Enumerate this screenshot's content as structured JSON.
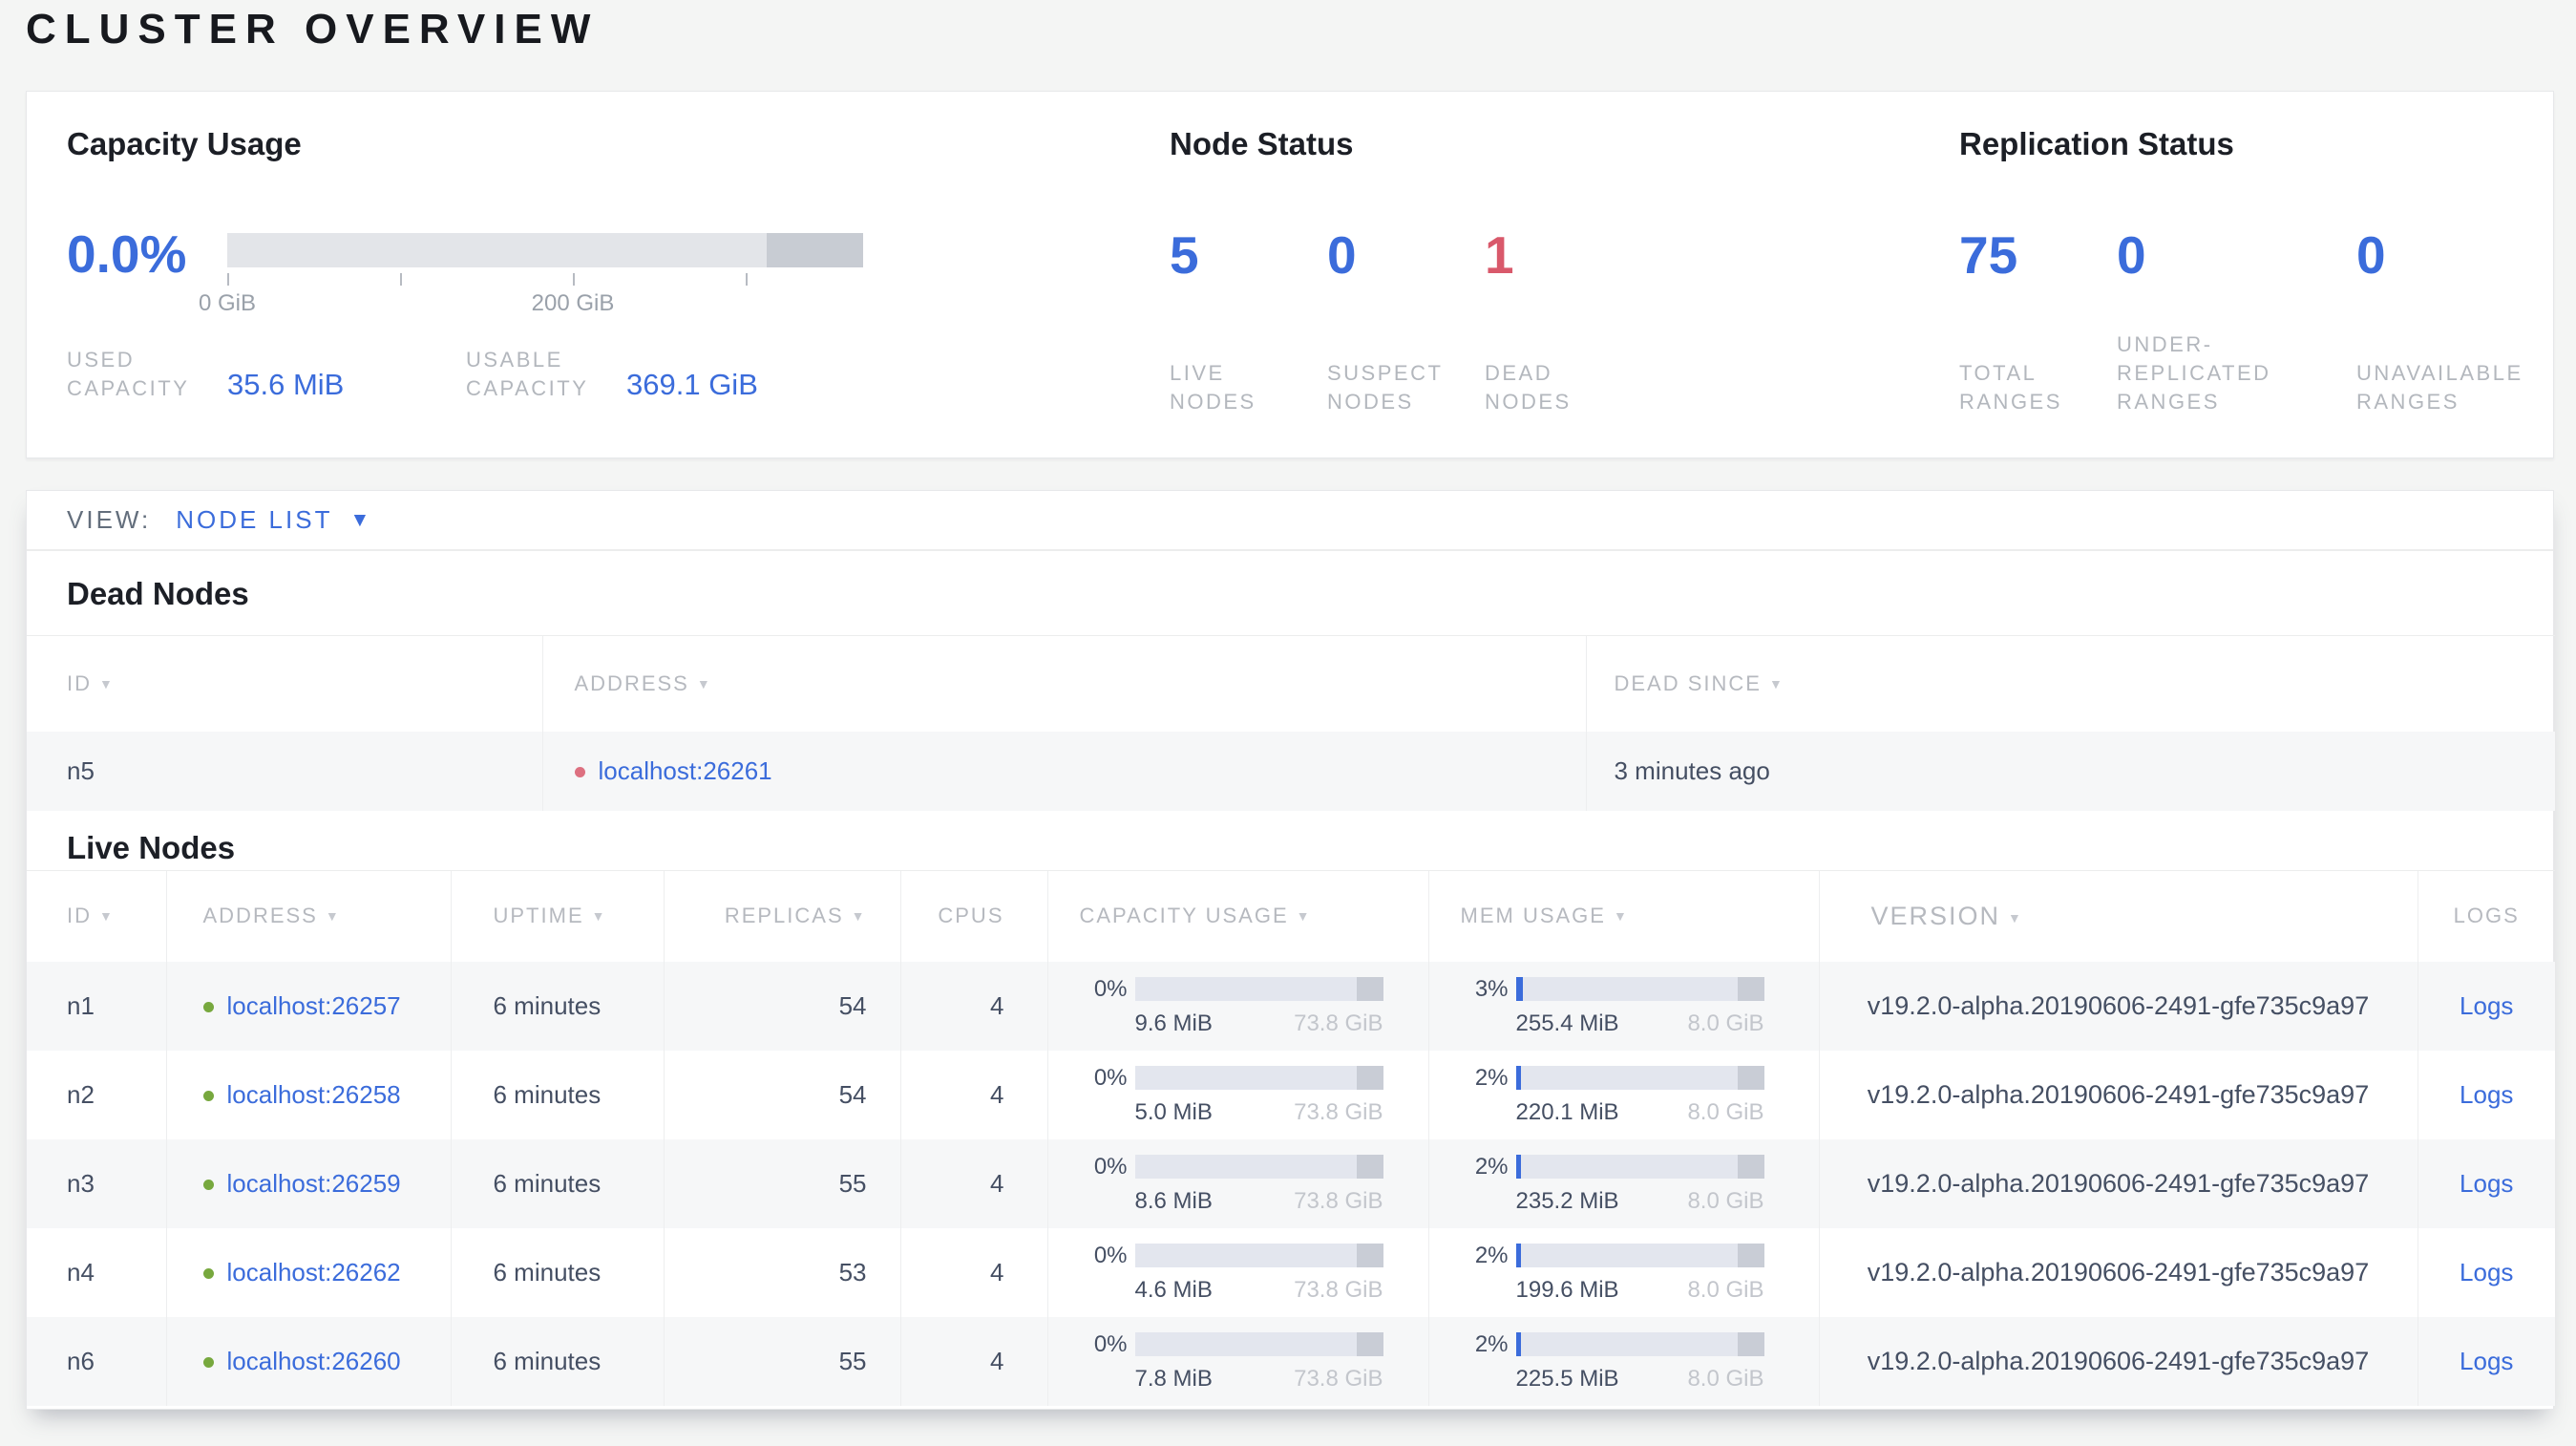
{
  "page_title": "CLUSTER OVERVIEW",
  "colors": {
    "accent_blue": "#3b6cdb",
    "danger_red": "#d9596b",
    "healthy_green": "#77a83e"
  },
  "capacity": {
    "title": "Capacity Usage",
    "percent": "0.0%",
    "tick_labels": [
      "0 GiB",
      "200 GiB"
    ],
    "used": {
      "label": "USED CAPACITY",
      "value": "35.6 MiB"
    },
    "usable": {
      "label": "USABLE CAPACITY",
      "value": "369.1 GiB"
    }
  },
  "node_status": {
    "title": "Node Status",
    "stats": [
      {
        "value": "5",
        "label": "LIVE NODES"
      },
      {
        "value": "0",
        "label": "SUSPECT NODES"
      },
      {
        "value": "1",
        "label": "DEAD NODES"
      }
    ]
  },
  "replication_status": {
    "title": "Replication Status",
    "stats": [
      {
        "value": "75",
        "label": "TOTAL RANGES"
      },
      {
        "value": "0",
        "label": "UNDER-REPLICATED RANGES"
      },
      {
        "value": "0",
        "label": "UNAVAILABLE RANGES"
      }
    ]
  },
  "view_bar": {
    "label": "VIEW:",
    "selected": "NODE LIST"
  },
  "dead_nodes": {
    "title": "Dead Nodes",
    "headers": {
      "id": "ID",
      "address": "ADDRESS",
      "dead_since": "DEAD SINCE"
    },
    "rows": [
      {
        "id": "n5",
        "address": "localhost:26261",
        "dead_since": "3 minutes ago"
      }
    ]
  },
  "live_nodes": {
    "title": "Live Nodes",
    "headers": {
      "id": "ID",
      "address": "ADDRESS",
      "uptime": "UPTIME",
      "replicas": "REPLICAS",
      "cpus": "CPUS",
      "capacity": "CAPACITY USAGE",
      "memory": "MEM USAGE",
      "version": "VERSION",
      "logs": "LOGS"
    },
    "rows": [
      {
        "id": "n1",
        "address": "localhost:26257",
        "uptime": "6 minutes",
        "replicas": "54",
        "cpus": "4",
        "cap_pct": "0%",
        "cap_fill": "0%",
        "cap_used": "9.6 MiB",
        "cap_total": "73.8 GiB",
        "mem_pct": "3%",
        "mem_fill": "3%",
        "mem_used": "255.4 MiB",
        "mem_total": "8.0 GiB",
        "version": "v19.2.0-alpha.20190606-2491-gfe735c9a97",
        "logs": "Logs"
      },
      {
        "id": "n2",
        "address": "localhost:26258",
        "uptime": "6 minutes",
        "replicas": "54",
        "cpus": "4",
        "cap_pct": "0%",
        "cap_fill": "0%",
        "cap_used": "5.0 MiB",
        "cap_total": "73.8 GiB",
        "mem_pct": "2%",
        "mem_fill": "2%",
        "mem_used": "220.1 MiB",
        "mem_total": "8.0 GiB",
        "version": "v19.2.0-alpha.20190606-2491-gfe735c9a97",
        "logs": "Logs"
      },
      {
        "id": "n3",
        "address": "localhost:26259",
        "uptime": "6 minutes",
        "replicas": "55",
        "cpus": "4",
        "cap_pct": "0%",
        "cap_fill": "0%",
        "cap_used": "8.6 MiB",
        "cap_total": "73.8 GiB",
        "mem_pct": "2%",
        "mem_fill": "2%",
        "mem_used": "235.2 MiB",
        "mem_total": "8.0 GiB",
        "version": "v19.2.0-alpha.20190606-2491-gfe735c9a97",
        "logs": "Logs"
      },
      {
        "id": "n4",
        "address": "localhost:26262",
        "uptime": "6 minutes",
        "replicas": "53",
        "cpus": "4",
        "cap_pct": "0%",
        "cap_fill": "0%",
        "cap_used": "4.6 MiB",
        "cap_total": "73.8 GiB",
        "mem_pct": "2%",
        "mem_fill": "2%",
        "mem_used": "199.6 MiB",
        "mem_total": "8.0 GiB",
        "version": "v19.2.0-alpha.20190606-2491-gfe735c9a97",
        "logs": "Logs"
      },
      {
        "id": "n6",
        "address": "localhost:26260",
        "uptime": "6 minutes",
        "replicas": "55",
        "cpus": "4",
        "cap_pct": "0%",
        "cap_fill": "0%",
        "cap_used": "7.8 MiB",
        "cap_total": "73.8 GiB",
        "mem_pct": "2%",
        "mem_fill": "2%",
        "mem_used": "225.5 MiB",
        "mem_total": "8.0 GiB",
        "version": "v19.2.0-alpha.20190606-2491-gfe735c9a97",
        "logs": "Logs"
      }
    ]
  }
}
